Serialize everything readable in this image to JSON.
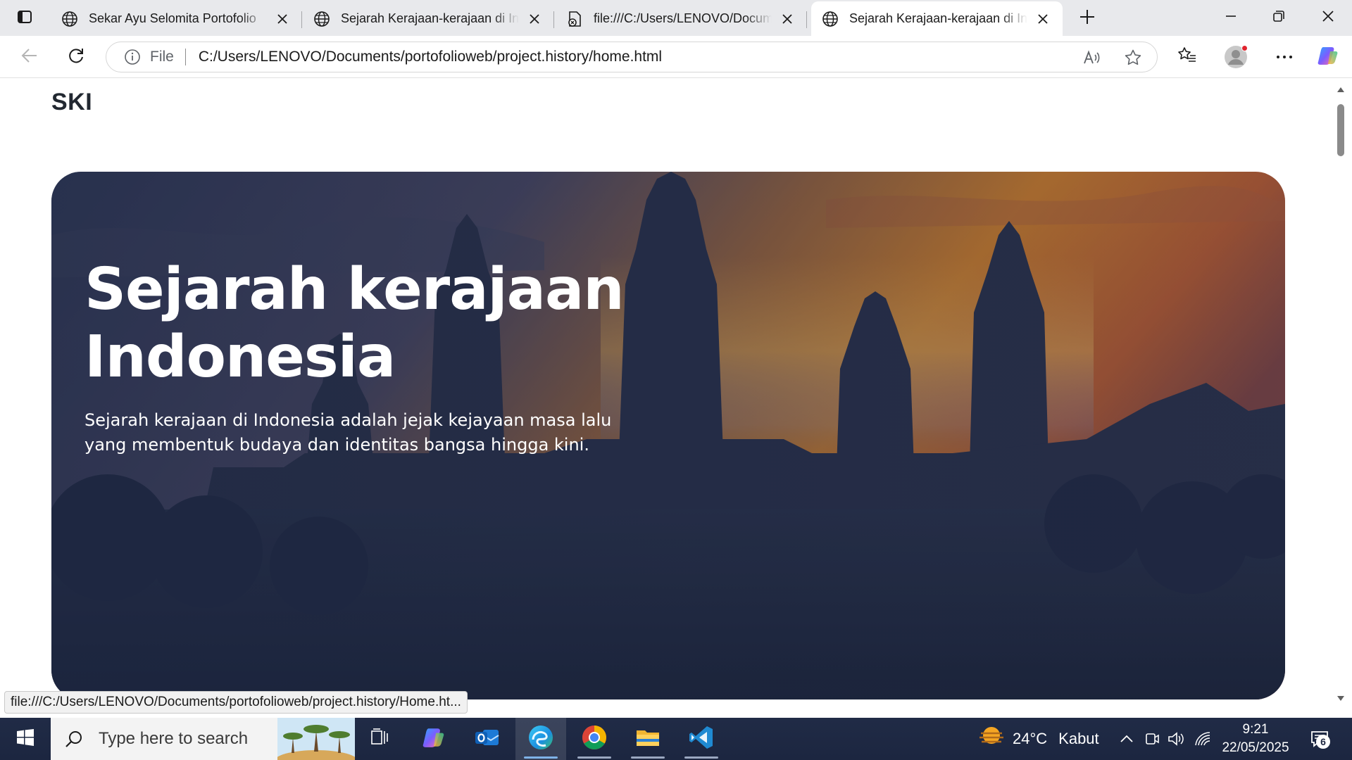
{
  "browser": {
    "tabs": [
      {
        "title": "Sekar Ayu Selomita Portofolio",
        "favicon": "globe-icon",
        "active": false
      },
      {
        "title": "Sejarah Kerajaan-kerajaan di Indonesia",
        "favicon": "globe-icon",
        "active": false
      },
      {
        "title": "file:///C:/Users/LENOVO/Documents/portofolioweb",
        "favicon": "file-error-icon",
        "active": false
      },
      {
        "title": "Sejarah Kerajaan-kerajaan di Indonesia",
        "favicon": "globe-icon",
        "active": true
      }
    ],
    "address": {
      "scheme_label": "File",
      "url": "C:/Users/LENOVO/Documents/portofolioweb/project.history/home.html"
    },
    "status_link": "file:///C:/Users/LENOVO/Documents/portofolioweb/project.history/Home.ht..."
  },
  "page": {
    "logo": "SKI",
    "hero": {
      "title": "Sejarah kerajaan Indonesia",
      "subtitle": "Sejarah kerajaan di Indonesia adalah jejak kejayaan masa lalu yang membentuk budaya dan identitas bangsa hingga kini."
    }
  },
  "taskbar": {
    "search_placeholder": "Type here to search",
    "weather": {
      "temp": "24°C",
      "condition": "Kabut"
    },
    "clock": {
      "time": "9:21",
      "date": "22/05/2025"
    },
    "notification_count": "6"
  },
  "colors": {
    "hero_sky_top": "#3b3f5c",
    "hero_sunset": "#e8892c",
    "hero_dark": "#1f2b45",
    "taskbar": "#1f2a44",
    "accent": "#7fb3e8"
  }
}
